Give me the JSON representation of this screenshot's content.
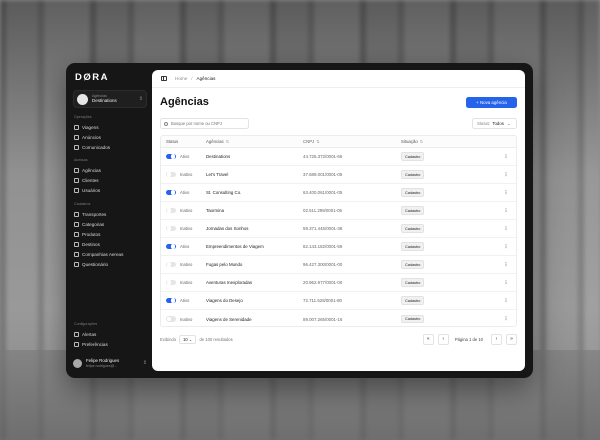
{
  "app": {
    "logo": "DØRA"
  },
  "org_switcher": {
    "label": "Agências",
    "name": "Destinations"
  },
  "sidebar": {
    "sections": [
      {
        "title": "Operações",
        "items": [
          {
            "label": "Viagens",
            "icon": "plane-icon"
          },
          {
            "label": "Anúncios",
            "icon": "megaphone-icon"
          },
          {
            "label": "Comunicados",
            "icon": "message-icon"
          }
        ]
      },
      {
        "title": "Acessos",
        "items": [
          {
            "label": "Agências",
            "icon": "building-icon"
          },
          {
            "label": "Clientes",
            "icon": "users-icon"
          },
          {
            "label": "Usuários",
            "icon": "user-icon"
          }
        ]
      },
      {
        "title": "Cadastros",
        "items": [
          {
            "label": "Transportes",
            "icon": "bus-icon"
          },
          {
            "label": "Categorias",
            "icon": "tag-icon"
          },
          {
            "label": "Produtos",
            "icon": "box-icon"
          },
          {
            "label": "Destinos",
            "icon": "map-pin-icon"
          },
          {
            "label": "Companhias Aereas",
            "icon": "plane-icon"
          },
          {
            "label": "Questionário",
            "icon": "clipboard-icon"
          }
        ]
      },
      {
        "title": "Configurações",
        "items": [
          {
            "label": "Alertas",
            "icon": "bell-icon"
          },
          {
            "label": "Preferências",
            "icon": "gear-icon"
          }
        ]
      }
    ],
    "user": {
      "name": "Felipe Rodrigues",
      "email": "felipe.rodrigues@..."
    }
  },
  "breadcrumb": {
    "home": "Home",
    "separator": "/",
    "current": "Agências"
  },
  "page": {
    "title": "Agências",
    "new_button": "+ Nova agência",
    "search_placeholder": "Busque por nome ou CNPJ",
    "status_filter": {
      "label": "Status:",
      "value": "Todos"
    }
  },
  "table": {
    "headers": {
      "status": "Status",
      "agency": "Agências",
      "cnpj": "CNPJ",
      "situation": "Situação"
    },
    "rows": [
      {
        "active": true,
        "status": "Ativo",
        "agency": "Destinations",
        "cnpj": "44.725.372/0001-66",
        "situation": "Cadastro"
      },
      {
        "active": false,
        "status": "Inativo",
        "agency": "Let's Travel",
        "cnpj": "37.689.001/0001-05",
        "situation": "Cadastro"
      },
      {
        "active": true,
        "status": "Ativo",
        "agency": "St. Consulting Co.",
        "cnpj": "63.400.061/0001-05",
        "situation": "Cadastro"
      },
      {
        "active": false,
        "status": "Inativo",
        "agency": "Taormina",
        "cnpj": "02.511.299/0001-05",
        "situation": "Cadastro"
      },
      {
        "active": false,
        "status": "Inativo",
        "agency": "Jornadas dos Sonhos",
        "cnpj": "59.371.445/0001-38",
        "situation": "Cadastro"
      },
      {
        "active": true,
        "status": "Ativo",
        "agency": "Empreendimentos de Viagem",
        "cnpj": "82.143.182/0001-59",
        "situation": "Cadastro"
      },
      {
        "active": false,
        "status": "Inativo",
        "agency": "Fugas pelo Mundo",
        "cnpj": "96.427.300/0001-00",
        "situation": "Cadastro"
      },
      {
        "active": false,
        "status": "Inativo",
        "agency": "Aventuras Inexploradas",
        "cnpj": "20.962.977/0001-00",
        "situation": "Cadastro"
      },
      {
        "active": true,
        "status": "Ativo",
        "agency": "Viagens do Desejo",
        "cnpj": "72.711.528/0001-80",
        "situation": "Cadastro"
      },
      {
        "active": false,
        "status": "Inativo",
        "agency": "Viagens de Serenidade",
        "cnpj": "89.007.265/0001-16",
        "situation": "Cadastro"
      }
    ]
  },
  "footer": {
    "showing_label": "Exibindo",
    "per_page": "10",
    "results_label": "de 100 resultados",
    "page_info": "Página 1 de 10"
  },
  "colors": {
    "accent": "#2563eb",
    "sidebar_bg": "#161616"
  }
}
